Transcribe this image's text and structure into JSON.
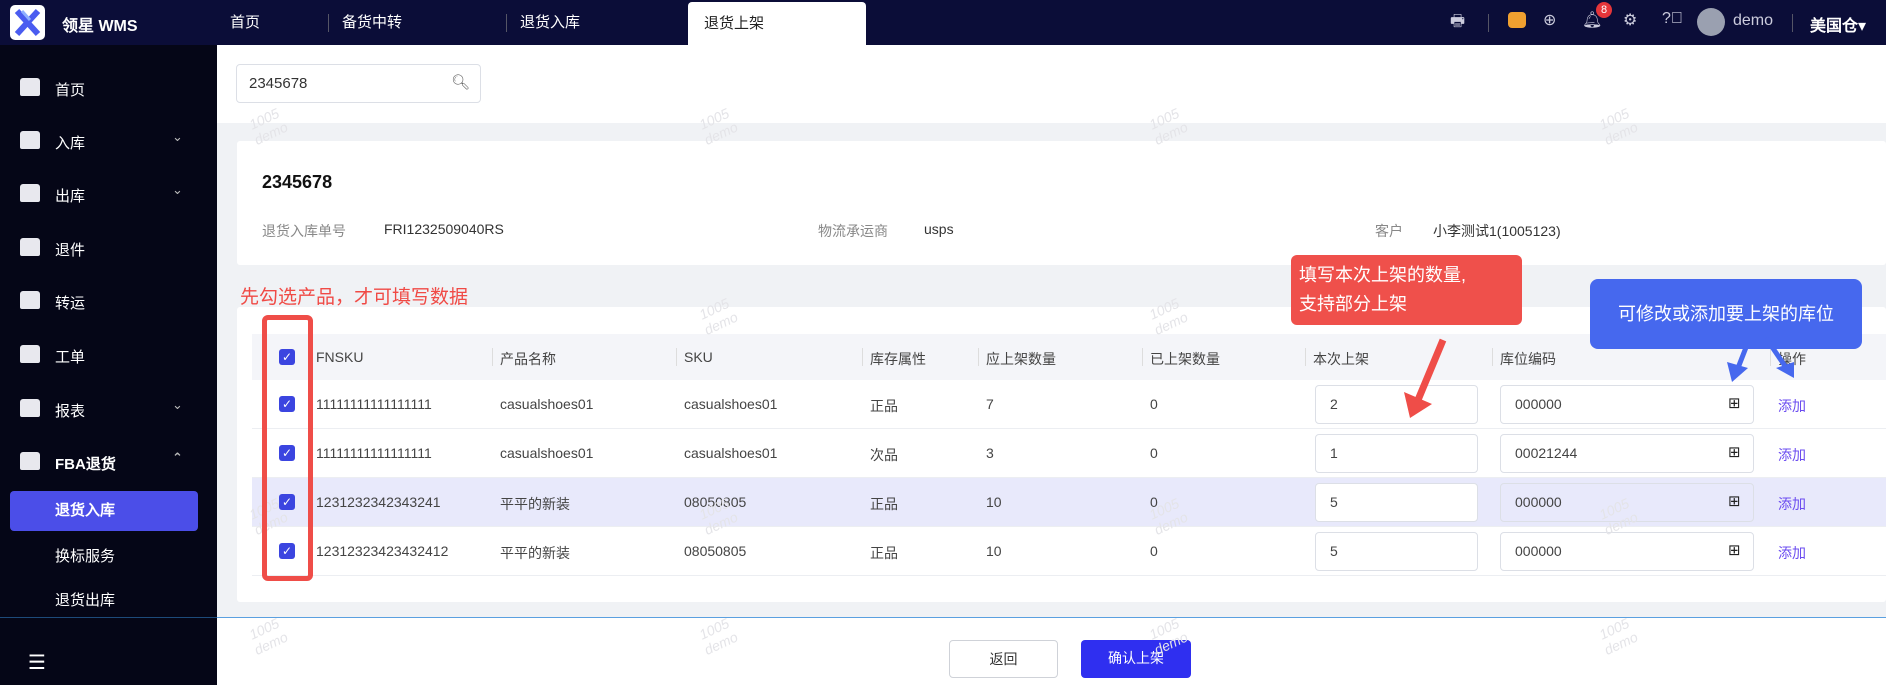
{
  "app": {
    "brand": "领星 WMS",
    "user": "demo",
    "warehouse": "美国仓",
    "notification_count": "8"
  },
  "tabs": [
    {
      "label": "首页"
    },
    {
      "label": "备货中转"
    },
    {
      "label": "退货入库"
    },
    {
      "label": "退货上架"
    }
  ],
  "sidebar": {
    "items": [
      {
        "label": "首页"
      },
      {
        "label": "入库"
      },
      {
        "label": "出库"
      },
      {
        "label": "退件"
      },
      {
        "label": "转运"
      },
      {
        "label": "工单"
      },
      {
        "label": "报表"
      },
      {
        "label": "FBA退货"
      }
    ],
    "sub_items": [
      {
        "label": "退货入库"
      },
      {
        "label": "换标服务"
      },
      {
        "label": "退货出库"
      }
    ]
  },
  "search": {
    "value": "2345678"
  },
  "order": {
    "title": "2345678",
    "return_no_label": "退货入库单号",
    "return_no": "FRI1232509040RS",
    "carrier_label": "物流承运商",
    "carrier": "usps",
    "customer_label": "客户",
    "customer": "小李测试1(1005123)"
  },
  "table": {
    "headers": [
      "FNSKU",
      "产品名称",
      "SKU",
      "库存属性",
      "应上架数量",
      "已上架数量",
      "本次上架",
      "库位编码",
      "操作"
    ],
    "rows": [
      {
        "fnsku": "11111111111111111",
        "name": "casualshoes01",
        "sku": "casualshoes01",
        "attr": "正品",
        "expected": "7",
        "shelved": "0",
        "qty": "2",
        "location": "000000",
        "action": "添加"
      },
      {
        "fnsku": "11111111111111111",
        "name": "casualshoes01",
        "sku": "casualshoes01",
        "attr": "次品",
        "expected": "3",
        "shelved": "0",
        "qty": "1",
        "location": "00021244",
        "action": "添加"
      },
      {
        "fnsku": "1231232342343241",
        "name": "平平的新装",
        "sku": "08050805",
        "attr": "正品",
        "expected": "10",
        "shelved": "0",
        "qty": "5",
        "location": "000000",
        "action": "添加"
      },
      {
        "fnsku": "12312323423432412",
        "name": "平平的新装",
        "sku": "08050805",
        "attr": "正品",
        "expected": "10",
        "shelved": "0",
        "qty": "5",
        "location": "000000",
        "action": "添加"
      }
    ]
  },
  "footer": {
    "back": "返回",
    "confirm": "确认上架"
  },
  "annotations": {
    "select_first": "先勾选产品，才可填写数据",
    "qty_tip_1": "填写本次上架的数量,",
    "qty_tip_2": "支持部分上架",
    "location_tip": "可修改或添加要上架的库位"
  },
  "watermark": {
    "line1": "1005",
    "line2": "demo"
  },
  "colors": {
    "accent": "#4b4ee8",
    "confirm": "#2f2ff0",
    "annotation_red": "#ef4d48",
    "annotation_blue": "#4668ee"
  }
}
